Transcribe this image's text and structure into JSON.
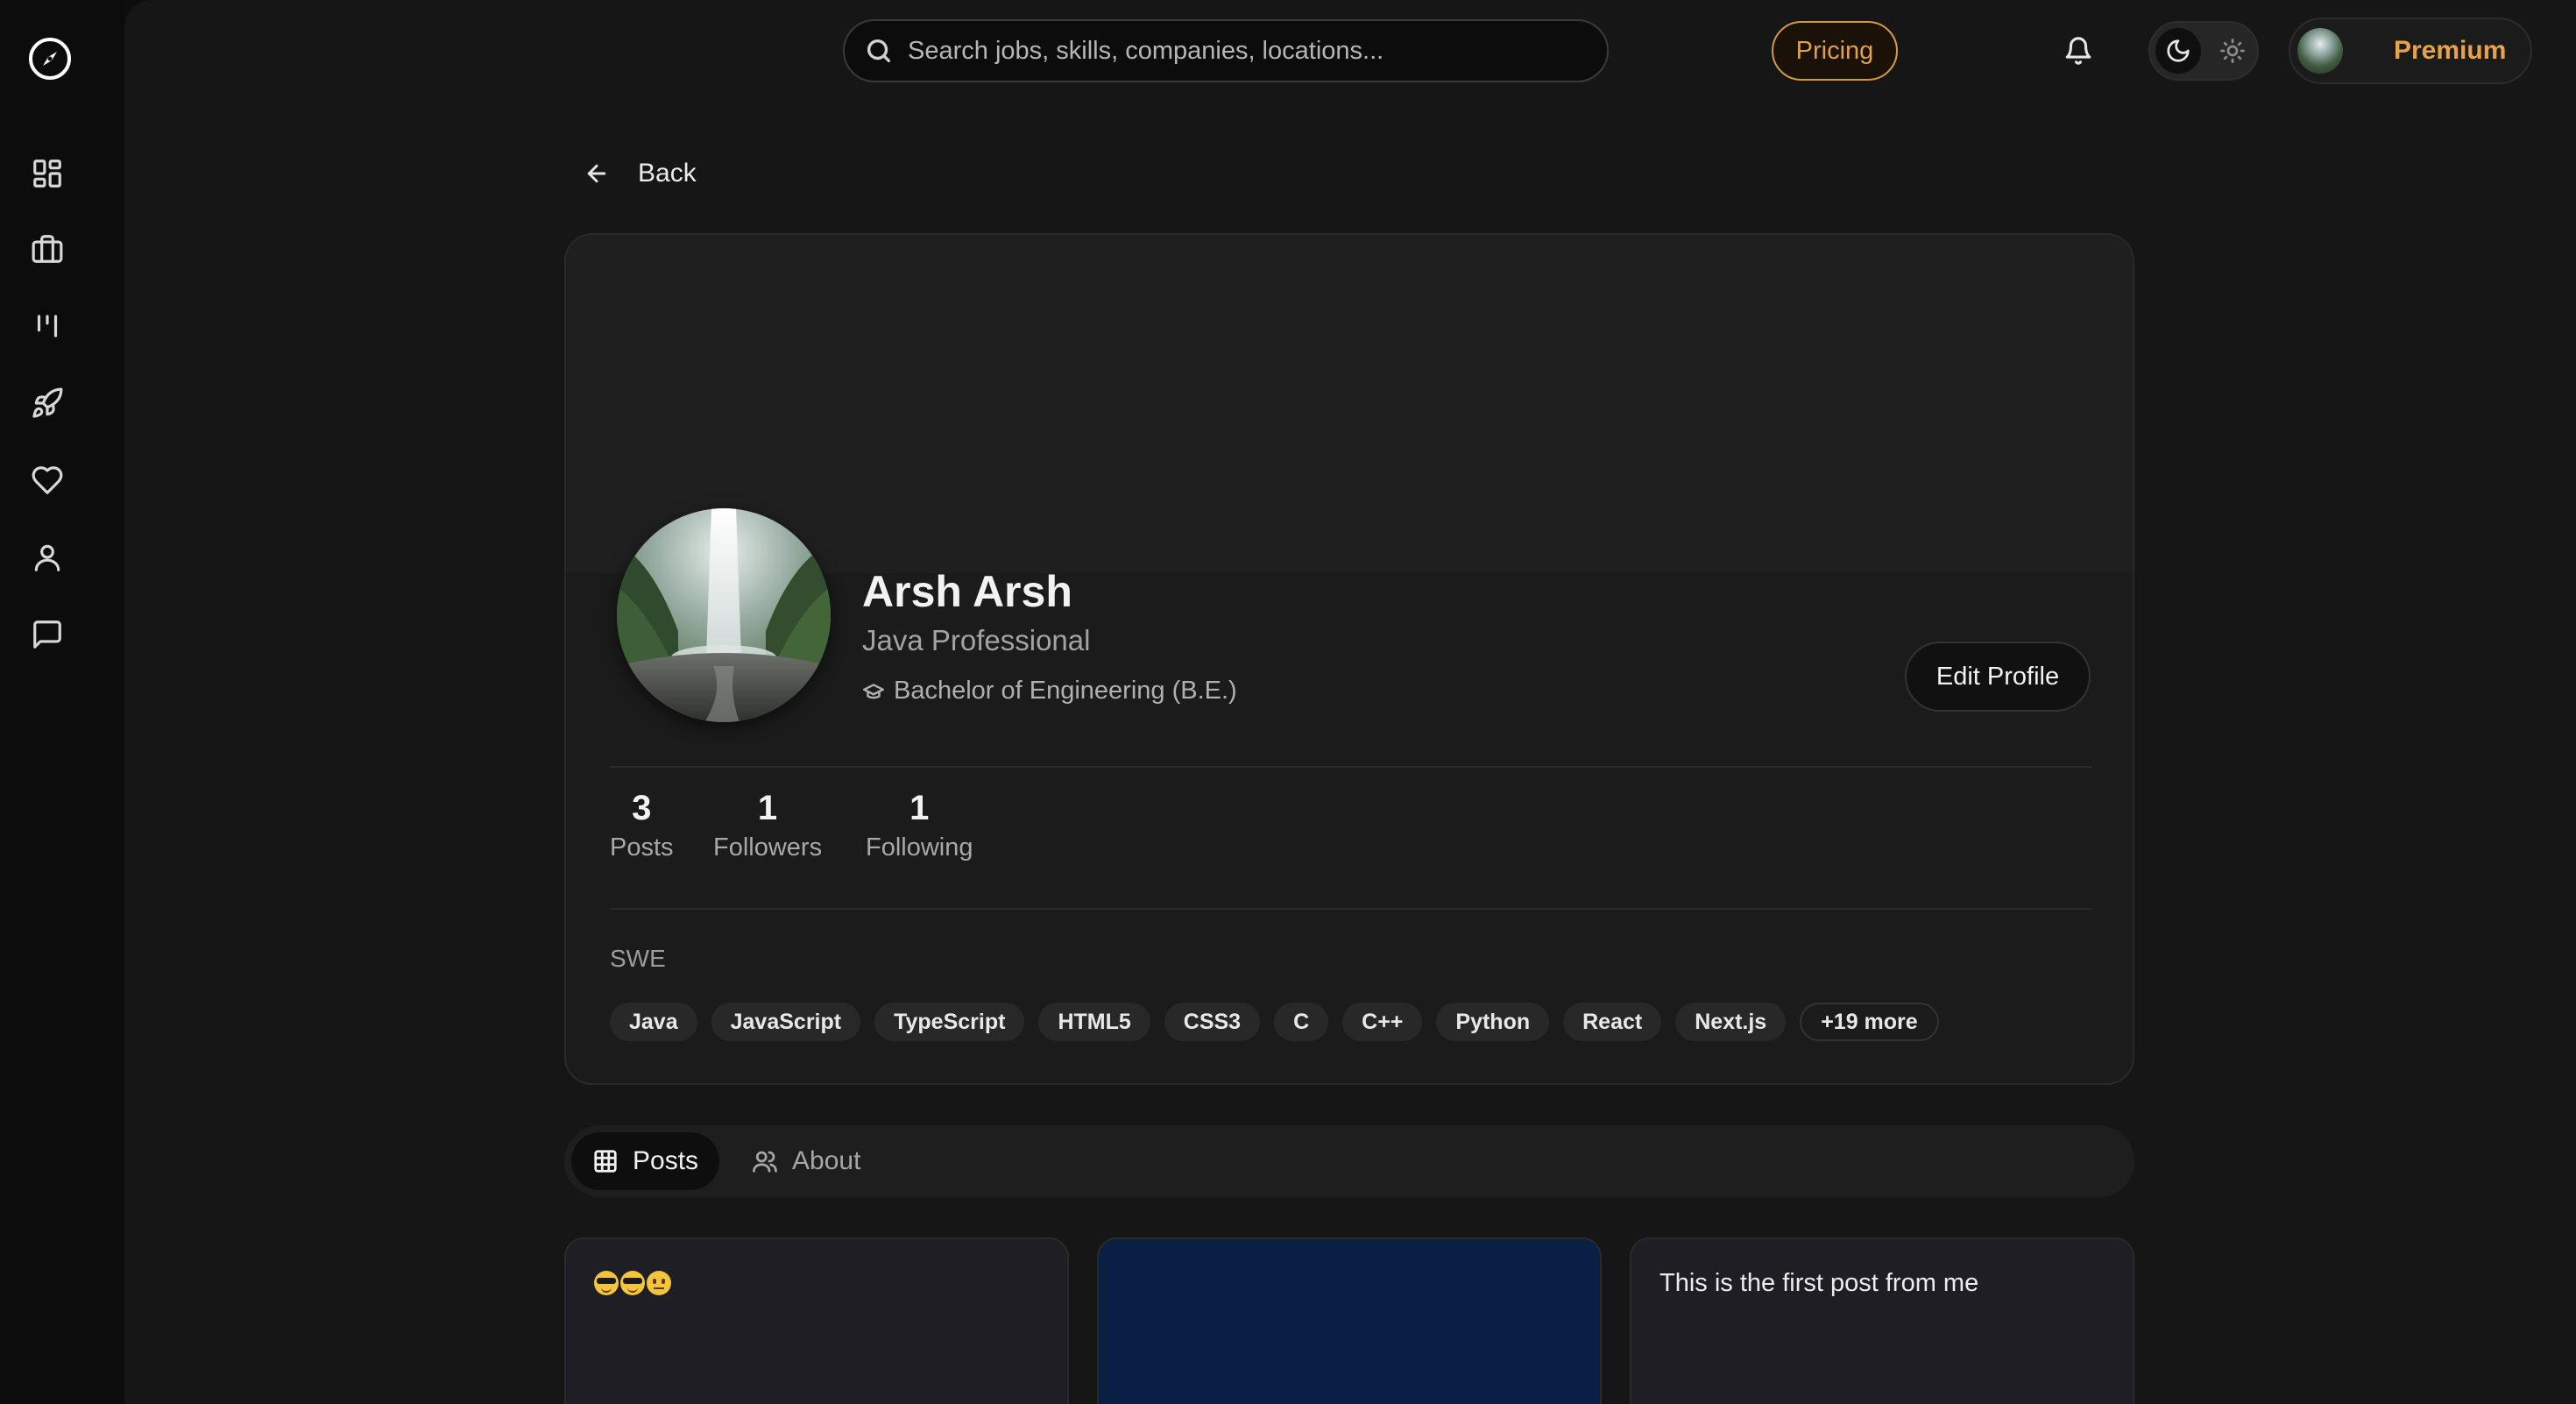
{
  "header": {
    "search_placeholder": "Search jobs, skills, companies, locations...",
    "pricing_label": "Pricing",
    "premium_label": "Premium"
  },
  "sidebar": {
    "items": [
      {
        "icon": "dashboard-icon"
      },
      {
        "icon": "briefcase-icon"
      },
      {
        "icon": "kanban-icon"
      },
      {
        "icon": "rocket-icon"
      },
      {
        "icon": "heart-icon"
      },
      {
        "icon": "user-icon"
      },
      {
        "icon": "message-icon"
      }
    ]
  },
  "back_label": "Back",
  "profile": {
    "name": "Arsh Arsh",
    "headline": "Java Professional",
    "education": "Bachelor of Engineering (B.E.)",
    "edit_label": "Edit Profile",
    "stats": [
      {
        "value": "3",
        "label": "Posts"
      },
      {
        "value": "1",
        "label": "Followers"
      },
      {
        "value": "1",
        "label": "Following"
      }
    ],
    "bio": "SWE",
    "skills": [
      "Java",
      "JavaScript",
      "TypeScript",
      "HTML5",
      "CSS3",
      "C",
      "C++",
      "Python",
      "React",
      "Next.js"
    ],
    "more_skills": "+19 more"
  },
  "tabs": [
    {
      "label": "Posts",
      "active": true
    },
    {
      "label": "About",
      "active": false
    }
  ],
  "posts": [
    {
      "emoji": [
        "😎",
        "😎",
        "😐"
      ],
      "text": ""
    },
    {
      "text": ""
    },
    {
      "text": "This is the first post from me"
    }
  ],
  "colors": {
    "accent": "#e0a048",
    "background": "#161616",
    "card": "#1b1b1b",
    "post_blue": "#0a1f44"
  }
}
